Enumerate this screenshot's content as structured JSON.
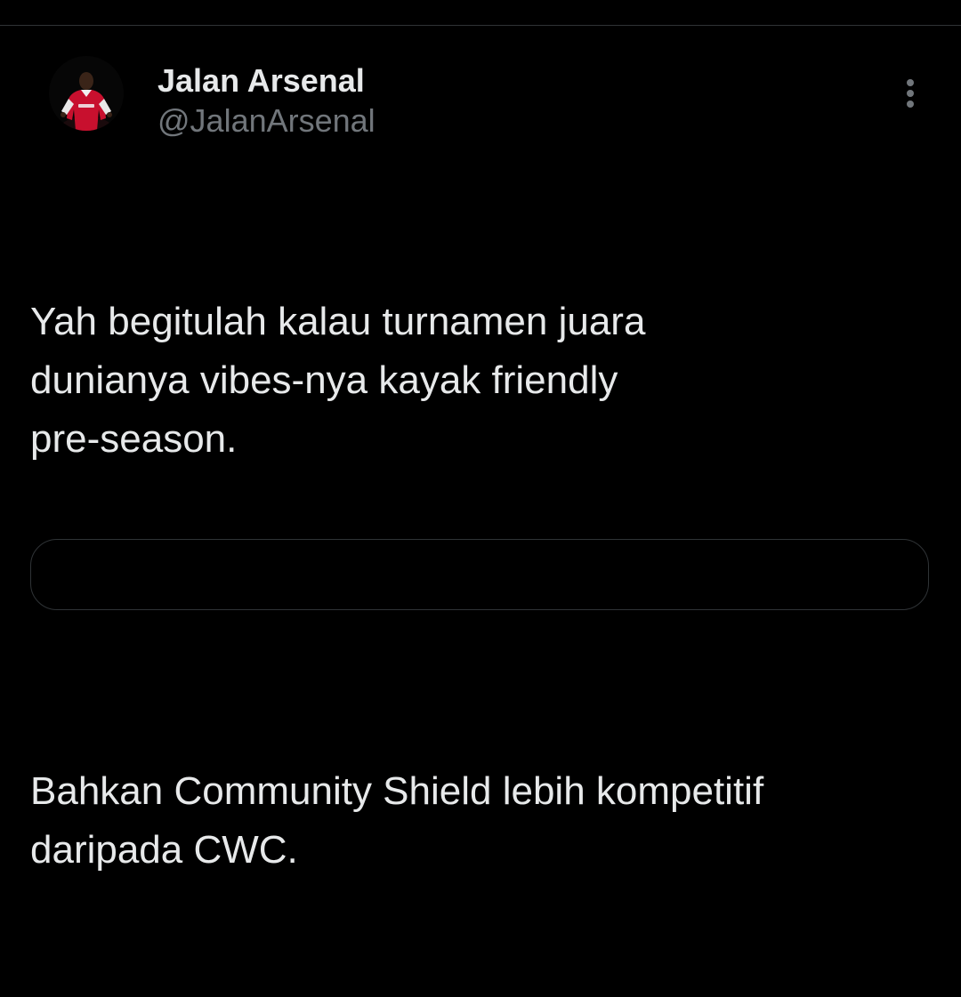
{
  "tweet": {
    "author": {
      "display_name": "Jalan Arsenal",
      "handle": "@JalanArsenal",
      "avatar_icon": "avatar-photo-icon"
    },
    "more_icon": "more-vertical-icon",
    "text_paragraphs": [
      "Yah begitulah kalau turnamen juara\ndunianya vibes-nya kayak friendly\npre-season.",
      "Bahkan Community Shield lebih kompetitif\ndaripada CWC."
    ]
  },
  "colors": {
    "background": "#000000",
    "primary_text": "#e7e9ea",
    "secondary_text": "#71767b",
    "border": "#2f3336",
    "jersey_red": "#c8102e"
  }
}
